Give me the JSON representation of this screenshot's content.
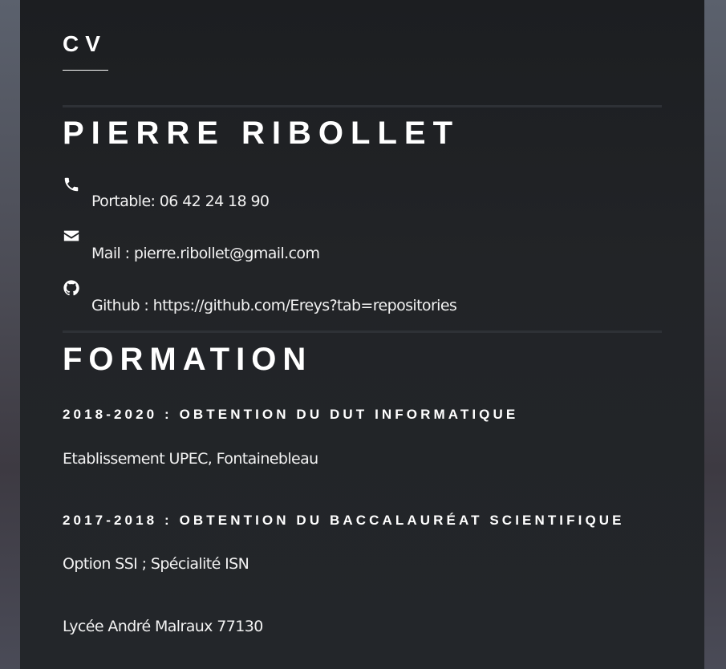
{
  "header": {
    "title": "CV",
    "name": "PIERRE RIBOLLET"
  },
  "contact": {
    "items": [
      {
        "icon": "phone-icon",
        "text": "Portable: 06 42 24 18 90"
      },
      {
        "icon": "envelope-icon",
        "text": "Mail : pierre.ribollet@gmail.com"
      },
      {
        "icon": "github-icon",
        "text": "Github : https://github.com/Ereys?tab=repositories"
      }
    ]
  },
  "formation": {
    "title": "FORMATION",
    "entries": [
      {
        "title": "2018-2020 : OBTENTION DU DUT INFORMATIQUE",
        "lines": [
          "Etablissement UPEC, Fontainebleau"
        ]
      },
      {
        "title": "2017-2018 : OBTENTION DU BACCALAURÉAT SCIENTIFIQUE",
        "lines": [
          "Option SSI ; Spécialité ISN",
          "Lycée André Malraux 77130"
        ]
      }
    ]
  }
}
